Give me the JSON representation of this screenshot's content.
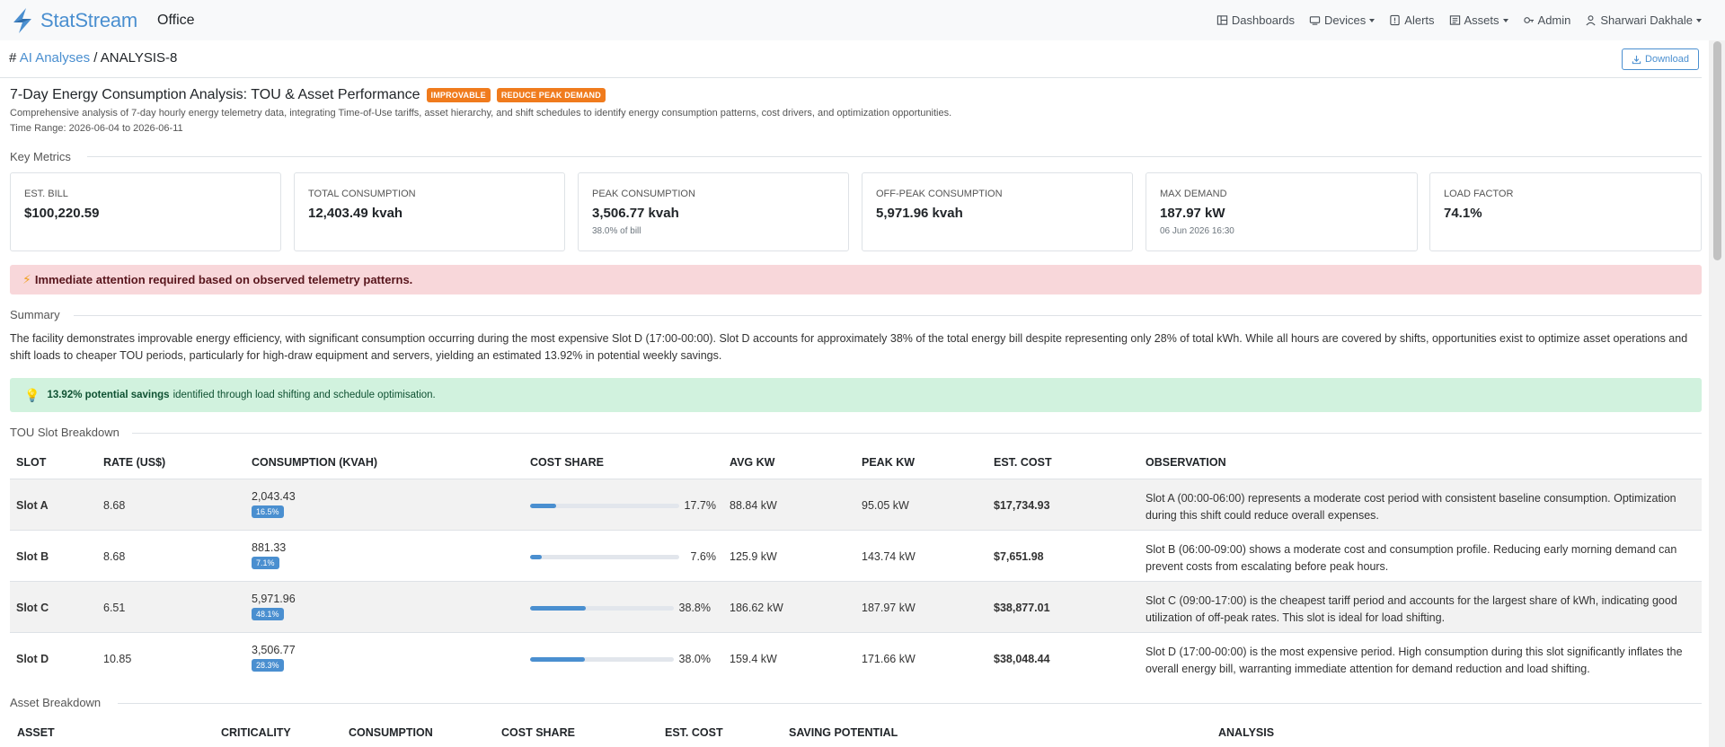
{
  "nav": {
    "brand": "StatStream",
    "org": "Office",
    "items": [
      {
        "label": "Dashboards",
        "icon": "dashboard-icon",
        "dropdown": false
      },
      {
        "label": "Devices",
        "icon": "devices-icon",
        "dropdown": true
      },
      {
        "label": "Alerts",
        "icon": "alert-icon",
        "dropdown": false
      },
      {
        "label": "Assets",
        "icon": "assets-icon",
        "dropdown": true
      },
      {
        "label": "Admin",
        "icon": "admin-icon",
        "dropdown": false
      },
      {
        "label": "Sharwari Dakhale",
        "icon": "user-icon",
        "dropdown": true
      }
    ]
  },
  "breadcrumb": {
    "hash": "#",
    "parent": "AI Analyses",
    "sep": "/",
    "current": "ANALYSIS-8"
  },
  "download_label": "Download",
  "report": {
    "title": "7-Day Energy Consumption Analysis: TOU & Asset Performance",
    "badges": [
      "IMPROVABLE",
      "REDUCE PEAK DEMAND"
    ],
    "description": "Comprehensive analysis of 7-day hourly energy telemetry data, integrating Time-of-Use tariffs, asset hierarchy, and shift schedules to identify energy consumption patterns, cost drivers, and optimization opportunities.",
    "time_range": "Time Range: 2026-06-04 to 2026-06-11"
  },
  "sections": {
    "key_metrics": "Key Metrics",
    "summary": "Summary",
    "tou": "TOU Slot Breakdown",
    "assets": "Asset Breakdown"
  },
  "metrics": [
    {
      "label": "EST. BILL",
      "value": "$100,220.59",
      "sub": ""
    },
    {
      "label": "TOTAL CONSUMPTION",
      "value": "12,403.49 kvah",
      "sub": ""
    },
    {
      "label": "PEAK CONSUMPTION",
      "value": "3,506.77 kvah",
      "sub": "38.0% of bill"
    },
    {
      "label": "OFF-PEAK CONSUMPTION",
      "value": "5,971.96 kvah",
      "sub": ""
    },
    {
      "label": "MAX DEMAND",
      "value": "187.97 kW",
      "sub": "06 Jun 2026 16:30"
    },
    {
      "label": "LOAD FACTOR",
      "value": "74.1%",
      "sub": ""
    }
  ],
  "alert": {
    "icon": "⚡",
    "text": "Immediate attention required based on observed telemetry patterns."
  },
  "summary_text": "The facility demonstrates improvable energy efficiency, with significant consumption occurring during the most expensive Slot D (17:00-00:00). Slot D accounts for approximately 38% of the total energy bill despite representing only 28% of total kWh. While all hours are covered by shifts, opportunities exist to optimize asset operations and shift loads to cheaper TOU periods, particularly for high-draw equipment and servers, yielding an estimated 13.92% in potential weekly savings.",
  "savings": {
    "icon": "💡",
    "bold": "13.92% potential savings",
    "rest": "identified through load shifting and schedule optimisation."
  },
  "tou_table": {
    "headers": [
      "SLOT",
      "RATE (US$)",
      "CONSUMPTION (KVAH)",
      "COST SHARE",
      "AVG KW",
      "PEAK KW",
      "EST. COST",
      "OBSERVATION"
    ],
    "rows": [
      {
        "slot": "Slot A",
        "rate": "8.68",
        "consumption": "2,043.43",
        "cons_pct": "16.5%",
        "cost_share": 17.7,
        "cost_share_label": "17.7%",
        "avg_kw": "88.84 kW",
        "peak_kw": "95.05 kW",
        "est_cost": "$17,734.93",
        "observation": "Slot A (00:00-06:00) represents a moderate cost period with consistent baseline consumption. Optimization during this shift could reduce overall expenses."
      },
      {
        "slot": "Slot B",
        "rate": "8.68",
        "consumption": "881.33",
        "cons_pct": "7.1%",
        "cost_share": 7.6,
        "cost_share_label": "7.6%",
        "avg_kw": "125.9 kW",
        "peak_kw": "143.74 kW",
        "est_cost": "$7,651.98",
        "observation": "Slot B (06:00-09:00) shows a moderate cost and consumption profile. Reducing early morning demand can prevent costs from escalating before peak hours."
      },
      {
        "slot": "Slot C",
        "rate": "6.51",
        "consumption": "5,971.96",
        "cons_pct": "48.1%",
        "cost_share": 38.8,
        "cost_share_label": "38.8%",
        "avg_kw": "186.62 kW",
        "peak_kw": "187.97 kW",
        "est_cost": "$38,877.01",
        "observation": "Slot C (09:00-17:00) is the cheapest tariff period and accounts for the largest share of kWh, indicating good utilization of off-peak rates. This slot is ideal for load shifting."
      },
      {
        "slot": "Slot D",
        "rate": "10.85",
        "consumption": "3,506.77",
        "cons_pct": "28.3%",
        "cost_share": 38.0,
        "cost_share_label": "38.0%",
        "avg_kw": "159.4 kW",
        "peak_kw": "171.66 kW",
        "est_cost": "$38,048.44",
        "observation": "Slot D (17:00-00:00) is the most expensive period. High consumption during this slot significantly inflates the overall energy bill, warranting immediate attention for demand reduction and load shifting."
      }
    ]
  },
  "asset_table": {
    "headers": [
      "ASSET",
      "CRITICALITY",
      "CONSUMPTION",
      "COST SHARE",
      "EST. COST",
      "SAVING POTENTIAL",
      "ANALYSIS"
    ]
  },
  "colors": {
    "accent": "#4a8fd0",
    "badge": "#f07b1d",
    "alert_bg": "#f8d7da",
    "success_bg": "#d1f2de"
  }
}
